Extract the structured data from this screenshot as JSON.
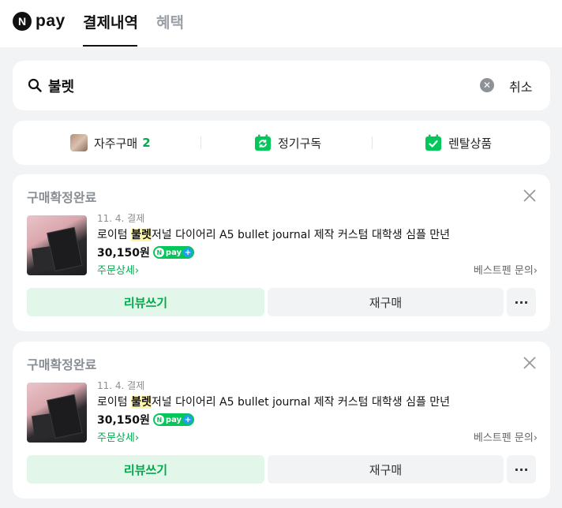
{
  "header": {
    "logo_text": "pay",
    "logo_badge": "N",
    "tabs": [
      {
        "label": "결제내역",
        "active": true
      },
      {
        "label": "혜택",
        "active": false
      }
    ]
  },
  "search": {
    "value": "불렛",
    "cancel_label": "취소"
  },
  "filters": [
    {
      "label": "자주구매",
      "count": "2",
      "icon": "product-thumbnail-icon"
    },
    {
      "label": "정기구독",
      "icon": "calendar-repeat-icon"
    },
    {
      "label": "렌탈상품",
      "icon": "calendar-check-icon"
    }
  ],
  "orders": [
    {
      "status": "구매확정완료",
      "date": "11. 4. 결제",
      "title_prefix": "로이텀 ",
      "title_highlight": "불렛",
      "title_suffix": "저널 다이어리 A5 bullet journal 제작 커스텀 대학생 심플 만년",
      "price": "30,150원",
      "npay_label": "pay",
      "detail_link": "주문상세",
      "inquiry_link": "베스트펜 문의",
      "review_button": "리뷰쓰기",
      "rebuy_button": "재구매",
      "more_button": "···"
    },
    {
      "status": "구매확정완료",
      "date": "11. 4. 결제",
      "title_prefix": "로이텀 ",
      "title_highlight": "불렛",
      "title_suffix": "저널 다이어리 A5 bullet journal 제작 커스텀 대학생 심플 만년",
      "price": "30,150원",
      "npay_label": "pay",
      "detail_link": "주문상세",
      "inquiry_link": "베스트펜 문의",
      "review_button": "리뷰쓰기",
      "rebuy_button": "재구매",
      "more_button": "···"
    }
  ],
  "colors": {
    "brand_green": "#03c75a",
    "accent_text_green": "#03a94d",
    "highlight_yellow": "#fff5a8"
  }
}
